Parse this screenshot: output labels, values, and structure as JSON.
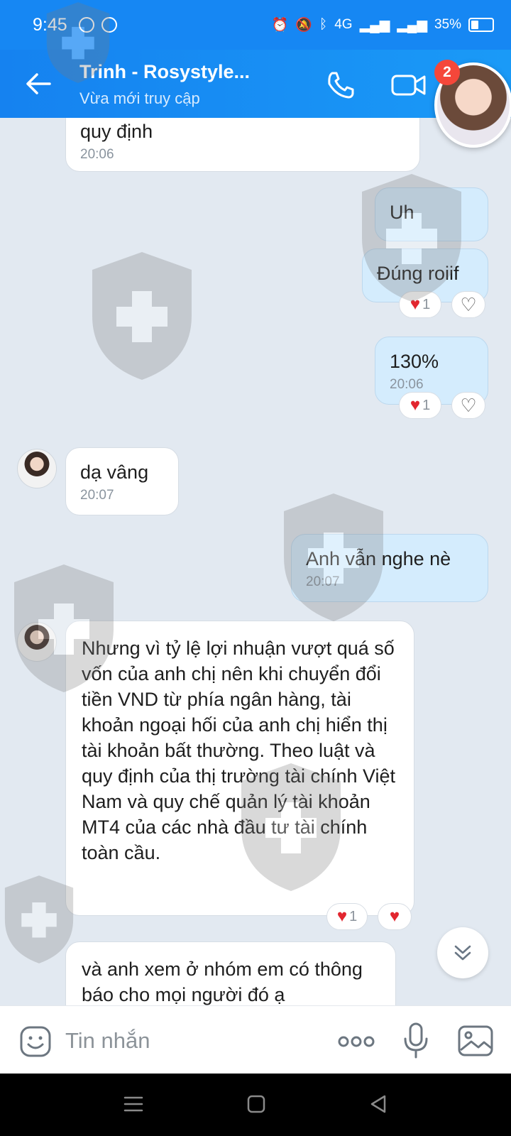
{
  "status_bar": {
    "time": "9:45",
    "battery": "35%",
    "network": "4G"
  },
  "header": {
    "title": "Trinh - Rosystyle...",
    "subtitle": "Vừa mới truy cập",
    "badge_count": "2"
  },
  "messages": [
    {
      "direction": "in",
      "text": "quy định",
      "time": "20:06"
    },
    {
      "direction": "out",
      "text": "Uh",
      "time": ""
    },
    {
      "direction": "out",
      "text": "Đúng roiif",
      "time": "",
      "reaction_count": "1"
    },
    {
      "direction": "out",
      "text": "130%",
      "time": "20:06",
      "reaction_count": "1"
    },
    {
      "direction": "in",
      "text": "dạ vâng",
      "time": "20:07"
    },
    {
      "direction": "out",
      "text": "Anh vẫn nghe nè",
      "time": "20:07"
    },
    {
      "direction": "in",
      "text": "Nhưng vì tỷ lệ lợi nhuận vượt quá số vốn của anh chị nên khi chuyển đổi tiền VND từ phía ngân hàng, tài khoản ngoại hối của anh chị  hiển thị tài khoản bất thường. Theo luật và quy định của thị trường tài chính Việt Nam và quy chế quản lý tài khoản MT4 của các nhà đầu tư tài chính toàn cầu.",
      "time": "",
      "reaction_count": "1"
    },
    {
      "direction": "in",
      "text": "và anh xem ở nhóm em có thông báo cho mọi người đó ạ",
      "time": ""
    }
  ],
  "composer": {
    "placeholder": "Tin nhắn"
  },
  "colors": {
    "header": "#1687f3",
    "outgoing_bubble": "#d4ecfd",
    "incoming_bubble": "#ffffff",
    "chat_background": "#e2e9f1",
    "reaction_heart": "#e2262f",
    "badge": "#f5473a"
  },
  "icons": {
    "back": "arrow-left-icon",
    "call": "phone-icon",
    "video": "video-camera-icon",
    "emoji": "emoji-icon",
    "more": "more-dots-icon",
    "mic": "microphone-icon",
    "image": "image-icon",
    "scroll_down": "double-chevron-down-icon"
  }
}
